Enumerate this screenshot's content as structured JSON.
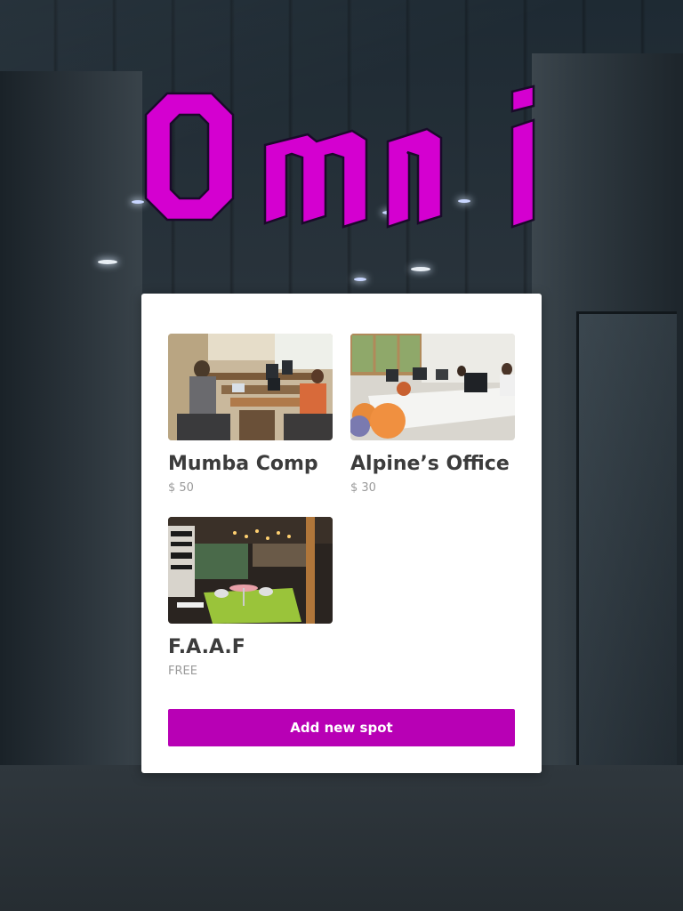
{
  "app": {
    "logo_text": "Omni",
    "brand_color": "#d400d0",
    "accent_color": "#b800b5"
  },
  "spots": [
    {
      "name": "Mumba Comp",
      "price": "$ 50",
      "photo": "coworking-room-photo"
    },
    {
      "name": "Alpine’s Office",
      "price": "$ 30",
      "photo": "open-office-photo"
    },
    {
      "name": "F.A.A.F",
      "price": "FREE",
      "photo": "lounge-cafe-photo"
    }
  ],
  "actions": {
    "add_spot_label": "Add new spot"
  }
}
